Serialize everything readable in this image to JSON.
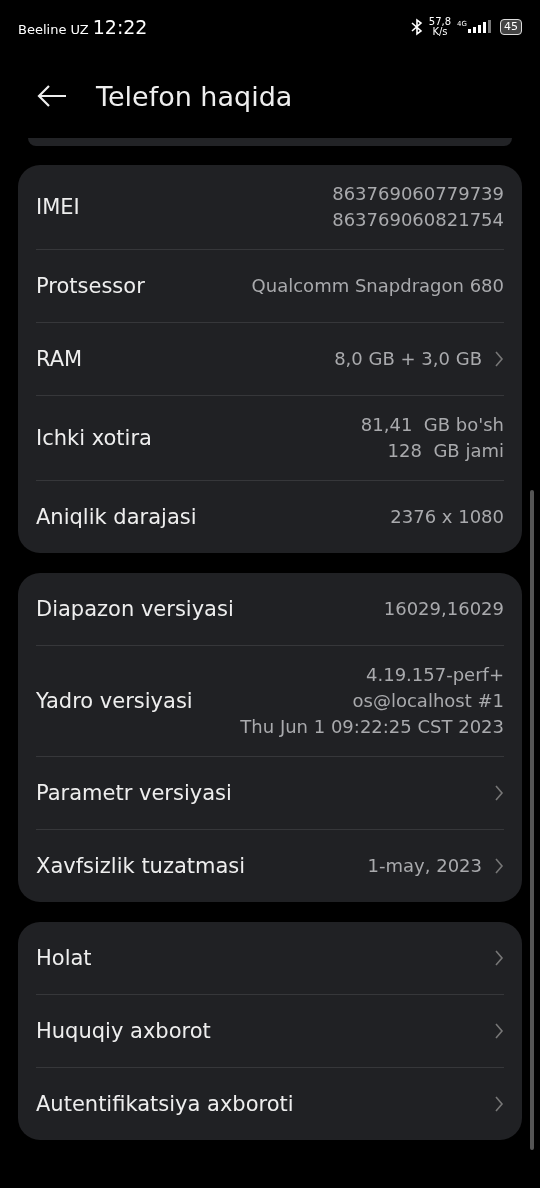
{
  "status_bar": {
    "carrier": "Beeline UZ",
    "time": "12:22",
    "speed_value": "57,8",
    "speed_unit": "K/s",
    "network": "4G",
    "battery": "45"
  },
  "header": {
    "title": "Telefon haqida"
  },
  "groups": [
    {
      "rows": [
        {
          "label": "IMEI",
          "value": [
            "863769060779739",
            "863769060821754"
          ],
          "chevron": false
        },
        {
          "label": "Protsessor",
          "value": [
            "Qualcomm Snapdragon 680"
          ],
          "chevron": false
        },
        {
          "label": "RAM",
          "value": [
            "8,0 GB + 3,0 GB"
          ],
          "chevron": true
        },
        {
          "label": "Ichki xotira",
          "value": [
            "81,41  GB bo'sh",
            "128  GB jami"
          ],
          "chevron": false
        },
        {
          "label": "Aniqlik darajasi",
          "value": [
            "2376 x 1080"
          ],
          "chevron": false
        }
      ]
    },
    {
      "rows": [
        {
          "label": "Diapazon versiyasi",
          "value": [
            "16029,16029"
          ],
          "chevron": false
        },
        {
          "label": "Yadro versiyasi",
          "value": [
            "4.19.157-perf+",
            "os@localhost #1",
            "Thu Jun 1 09:22:25 CST 2023"
          ],
          "chevron": false
        },
        {
          "label": "Parametr versiyasi",
          "value": [],
          "chevron": true
        },
        {
          "label": "Xavfsizlik tuzatmasi",
          "value": [
            "1-may, 2023"
          ],
          "chevron": true
        }
      ]
    },
    {
      "rows": [
        {
          "label": "Holat",
          "value": [],
          "chevron": true
        },
        {
          "label": "Huquqiy axborot",
          "value": [],
          "chevron": true
        },
        {
          "label": "Autentifikatsiya axboroti",
          "value": [],
          "chevron": true
        }
      ]
    }
  ]
}
